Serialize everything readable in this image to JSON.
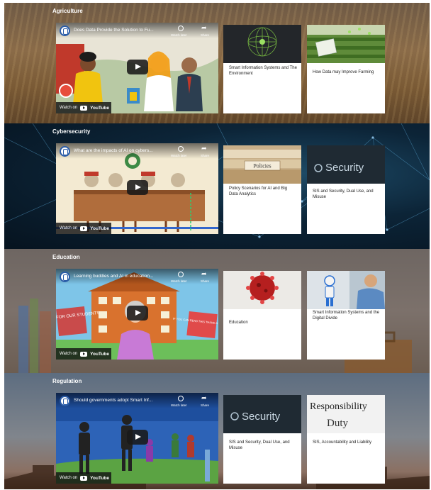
{
  "sections": [
    {
      "title": "Agriculture",
      "video": {
        "title": "Does Data Provide the Solution to Fu...",
        "watch_on": "Watch on",
        "brand": "YouTube",
        "watch_later": "Watch later",
        "share": "Share"
      },
      "cards": [
        {
          "label": "Smart Information Systems and The Environment"
        },
        {
          "label": "How Data may Improve Farming"
        }
      ]
    },
    {
      "title": "Cybersecurity",
      "video": {
        "title": "What are the impacts of AI on cybers...",
        "watch_on": "Watch on",
        "brand": "YouTube",
        "watch_later": "Watch later",
        "share": "Share"
      },
      "cards": [
        {
          "label": "Policy Scenarios for AI and Big Data Analytics",
          "thumb_text": "Policies"
        },
        {
          "label": "SIS and Security, Dual Use, and Misuse",
          "thumb_text": "Security"
        }
      ]
    },
    {
      "title": "Education",
      "video": {
        "title": "Learning buddies and AI in education...",
        "watch_on": "Watch on",
        "brand": "YouTube",
        "watch_later": "Watch later",
        "share": "Share",
        "sign_left": "STRIKE FOR OUR STUDENTS",
        "sign_right": "IF YOU CAN READ THIS THANK A TEACHER"
      },
      "cards": [
        {
          "label": "Education"
        },
        {
          "label": "Smart Information Systems and the Digital Divide"
        }
      ]
    },
    {
      "title": "Regulation",
      "video": {
        "title": "Should governments adopt Smart Inf...",
        "watch_on": "Watch on",
        "brand": "YouTube",
        "watch_later": "Watch later",
        "share": "Share"
      },
      "cards": [
        {
          "label": "SIS and Security, Dual Use, and Misuse",
          "thumb_text": "Security"
        },
        {
          "label": "SIS, Accountability and Liability",
          "thumb_text": "Responsibility",
          "thumb_text_2": "Duty"
        }
      ]
    }
  ]
}
